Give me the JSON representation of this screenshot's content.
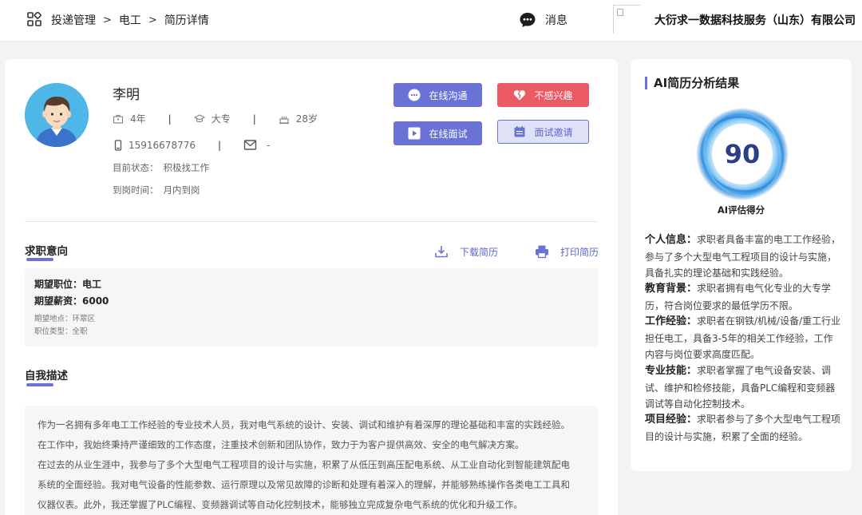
{
  "header": {
    "breadcrumb": [
      "投递管理",
      "电工",
      "简历详情"
    ],
    "messages_label": "消息",
    "company": "大衍求一数据科技服务（山东）有限公司"
  },
  "profile": {
    "name": "李明",
    "experience": "4年",
    "education": "大专",
    "age": "28岁",
    "phone": "15916678776",
    "email": "-",
    "status_label": "目前状态：",
    "status_value": "积极找工作",
    "arrival_label": "到岗时间：",
    "arrival_value": "月内到岗"
  },
  "buttons": {
    "chat": "在线沟通",
    "video": "在线面试",
    "not_interested": "不感兴趣",
    "invite": "面试邀请"
  },
  "intent": {
    "title": "求职意向",
    "download": "下载简历",
    "print": "打印简历",
    "position": "期望职位：电工",
    "salary": "期望薪资：6000",
    "location": "期望地点：环翠区",
    "job_type": "职位类型：全职"
  },
  "self_desc": {
    "title": "自我描述",
    "lines": [
      "作为一名拥有多年电工工作经验的专业技术人员，我对电气系统的设计、安装、调试和维护有着深厚的理论基础和丰富的实践经验。",
      "在工作中，我始终秉持严谨细致的工作态度，注重技术创新和团队协作，致力于为客户提供高效、安全的电气解决方案。",
      "在过去的从业生涯中，我参与了多个大型电气工程项目的设计与实施，积累了从低压到高压配电系统、从工业自动化到智能建筑配电",
      "系统的全面经验。我对电气设备的性能参数、运行原理以及常见故障的诊断和处理有着深入的理解，并能够熟练操作各类电工工具和",
      "仪器仪表。此外，我还掌握了PLC编程、变频器调试等自动化控制技术，能够独立完成复杂电气系统的优化和升级工作。"
    ]
  },
  "ai": {
    "title": "AI简历分析结果",
    "score": "90",
    "score_label": "AI评估得分",
    "items": [
      {
        "label": "个人信息：",
        "text": "求职者具备丰富的电工工作经验，参与了多个大型电气工程项目的设计与实施，具备扎实的理论基础和实践经验。"
      },
      {
        "label": "教育背景：",
        "text": "求职者拥有电气化专业的大专学历，符合岗位要求的最低学历不限。"
      },
      {
        "label": "工作经验：",
        "text": "求职者在钢铁/机械/设备/重工行业担任电工，具备3-5年的相关工作经验，工作内容与岗位要求高度匹配。"
      },
      {
        "label": "专业技能：",
        "text": "求职者掌握了电气设备安装、调试、维护和检修技能，具备PLC编程和变频器调试等自动化控制技术。"
      },
      {
        "label": "项目经验：",
        "text": "求职者参与了多个大型电气工程项目的设计与实施，积累了全面的经验。"
      }
    ]
  },
  "colors": {
    "accent": "#6a72d6",
    "danger": "#ec5a63",
    "score_text": "#2b3f86"
  }
}
